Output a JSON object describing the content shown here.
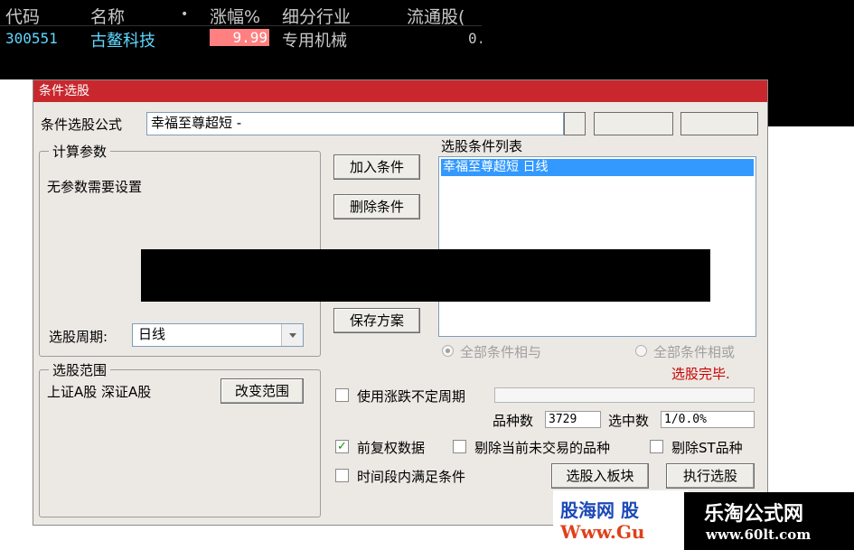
{
  "quote_list": {
    "headers": [
      "代码",
      "名称",
      "•",
      "涨幅%",
      "细分行业",
      "流通股("
    ],
    "row": {
      "code": "300551",
      "name": "古鳌科技",
      "change": "9.99",
      "industry": "专用机械",
      "float_shares": "0."
    },
    "colors": {
      "code": "#5fd7ff",
      "name": "#5fd7ff",
      "change_bg": "#ff8080",
      "industry": "#c8c8c8"
    }
  },
  "dialog": {
    "title": "条件选股",
    "title_color": "#c8282d",
    "formula_label": "条件选股公式",
    "formula_value": "幸福至尊超短 -",
    "params_group": "计算参数",
    "params_text": "无参数需要设置",
    "period_label": "选股周期:",
    "period_value": "日线",
    "range_group": "选股范围",
    "range_text": "上证A股  深证A股",
    "change_range_button": "改变范围",
    "add_condition_button": "加入条件",
    "delete_condition_button": "删除条件",
    "save_plan_button": "保存方案",
    "condition_list_label": "选股条件列表",
    "condition_items": [
      "幸福至尊超短   日线"
    ],
    "radio_and": "全部条件相与",
    "radio_or": "全部条件相或",
    "status": "选股完毕.",
    "status_color": "#c80000",
    "use_variable_period": "使用涨跌不定周期",
    "variety_count_label": "品种数",
    "variety_count_value": "3729",
    "selected_count_label": "选中数",
    "selected_count_value": "1/0.0%",
    "forward_adjust": "前复权数据",
    "forward_adjust_checked": true,
    "exclude_untraded": "剔除当前未交易的品种",
    "exclude_st": "剔除ST品种",
    "time_range_condition": "时间段内满足条件",
    "select_to_block_button": "选股入板块",
    "execute_button": "执行选股"
  },
  "watermarks": {
    "left_line1": "股海网 股",
    "left_line2": "Www.Gu",
    "right_line1": "乐淘公式网",
    "right_line2": "www.60lt.com"
  }
}
